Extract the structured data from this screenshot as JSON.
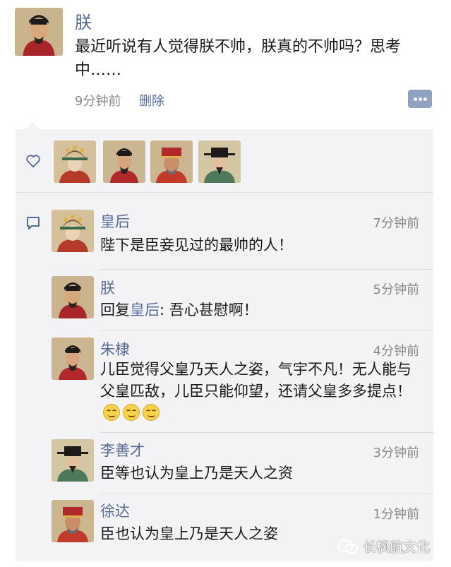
{
  "post": {
    "author": "朕",
    "text": "最近听说有人觉得朕不帅，朕真的不帅吗？思考中……",
    "time": "9分钟前",
    "delete_label": "删除"
  },
  "likes": {
    "icon": "heart-icon",
    "avatars": [
      "empress-portrait",
      "emperor-portrait",
      "general-portrait",
      "minister-portrait"
    ]
  },
  "comments": [
    {
      "author": "皇后",
      "time": "7分钟前",
      "text": "陛下是臣妾见过的最帅的人！"
    },
    {
      "author": "朕",
      "time": "5分钟前",
      "reply_prefix": "回复",
      "reply_to": "皇后",
      "reply_text": ": 吾心甚慰啊！"
    },
    {
      "author": "朱棣",
      "time": "4分钟前",
      "text": "儿臣觉得父皇乃天人之姿，气宇不凡！无人能与父皇匹敌，儿臣只能仰望，还请父皇多多提点！",
      "emoji": [
        "smile",
        "smile",
        "smile"
      ]
    },
    {
      "author": "李善才",
      "time": "3分钟前",
      "text": "臣等也认为皇上乃是天人之资"
    },
    {
      "author": "徐达",
      "time": "1分钟前",
      "text": "臣也认为皇上乃是天人之姿"
    }
  ],
  "watermark": "长枫航文化",
  "colors": {
    "link": "#576b95",
    "panel": "#f3f3f5",
    "time": "#8a8a8a"
  }
}
